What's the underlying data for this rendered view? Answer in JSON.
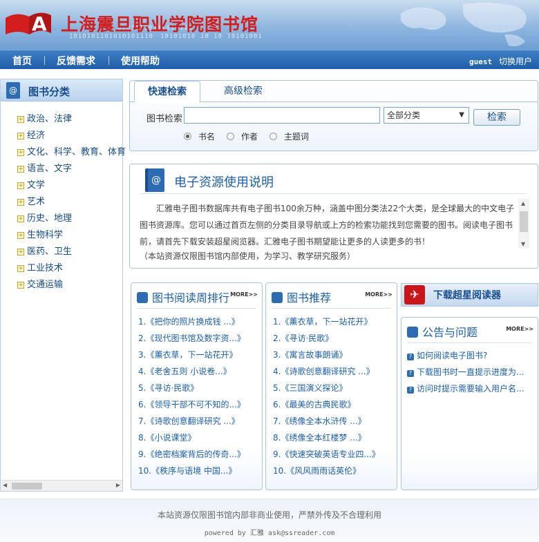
{
  "header": {
    "logo_letter": "A",
    "site_title": "上海震旦职业学院图书馆",
    "binary_decor": [
      "01010110101010110",
      "1010101101010101110",
      "10101010",
      "10 10 10101001"
    ]
  },
  "nav": {
    "items": [
      "首页",
      "反馈需求",
      "使用帮助"
    ],
    "user": "guest",
    "switch_user": "切换用户"
  },
  "sidebar": {
    "title": "图书分类",
    "categories": [
      "政治、法律",
      "经济",
      "文化、科学、教育、体育",
      "语言、文字",
      "文学",
      "艺术",
      "历史、地理",
      "生物科学",
      "医药、卫生",
      "工业技术",
      "交通运输"
    ]
  },
  "search": {
    "tab_quick": "快速检索",
    "tab_advanced": "高级检索",
    "label": "图书检索",
    "input_value": "",
    "select_value": "全部分类",
    "button": "检索",
    "options": [
      "书名",
      "作者",
      "主题词"
    ],
    "selected_option": "书名"
  },
  "info": {
    "title": "电子资源使用说明",
    "text": "汇雅电子图书数据库共有电子图书100余万种，涵盖中图分类法22个大类，是全球最大的中文电子图书资源库。您可以通过首页左侧的分类目录导航或上方的检索功能找到您需要的图书。阅读电子图书前，请首先下载安装超星阅览器。汇雅电子图书期望能让更多的人读更多的书！",
    "note": "（本站资源仅限图书馆内部使用，为学习、教学研究服务）"
  },
  "weekly": {
    "title": "图书阅读周排行",
    "more": "MORE>>",
    "items": [
      "1.《把你的照片换成钱 ...》",
      "2.《现代图书馆及数字资...》",
      "3.《薰衣草，下一站花开》",
      "4.《老舍五则 小说卷...》",
      "5.《寻访·民歌》",
      "6.《领导干部不可不知的...》",
      "7.《诗歌创意翻译研究 ...》",
      "8.《小说课堂》",
      "9.《绝密档案背后的传奇...》",
      "10.《秩序与语境 中国...》"
    ]
  },
  "recommend": {
    "title": "图书推荐",
    "more": "MORE>>",
    "items": [
      "1.《薰衣草，下一站花开》",
      "2.《寻访·民歌》",
      "3.《寓言故事朗诵》",
      "4.《诗歌创意翻译研究 ...》",
      "5.《三国演义探论》",
      "6.《最美的古典民歌》",
      "7.《绣像全本水浒传 ...》",
      "8.《绣像全本红楼梦 ...》",
      "9.《快速突破英语专业四...》",
      "10.《风风雨雨话英伦》"
    ]
  },
  "download": {
    "label": "下载超星阅读器"
  },
  "notice": {
    "title": "公告与问题",
    "more": "MORE>>",
    "items": [
      "如何阅读电子图书?",
      "下载图书时一直提示进度为...",
      "访问时提示需要输入用户名..."
    ]
  },
  "footer": {
    "line1": "本站资源仅限图书馆内部非商业使用，严禁外传及不合理利用",
    "line2": "powered by 汇雅 ask@ssreader.com"
  },
  "colors": {
    "brand_red": "#d21e1e",
    "nav_blue": "#1e5ea8",
    "link_blue": "#1d5fa8"
  }
}
